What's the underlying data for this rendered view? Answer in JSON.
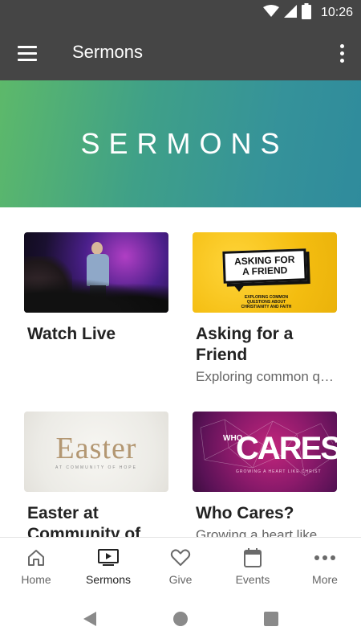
{
  "status_bar": {
    "time": "10:26"
  },
  "app_bar": {
    "title": "Sermons"
  },
  "hero": {
    "title": "SERMONS"
  },
  "cards": [
    {
      "title": "Watch Live",
      "subtitle": "",
      "thumb": "live-stage-photo"
    },
    {
      "title": "Asking for a Friend",
      "subtitle": "Exploring common q…",
      "thumb": "asking-for-a-friend-graphic",
      "thumb_text": {
        "headline_line1": "ASKING FOR",
        "headline_line2": "A FRIEND",
        "tagline": "EXPLORING COMMON QUESTIONS ABOUT CHRISTIANITY AND FAITH"
      }
    },
    {
      "title": "Easter at Community of",
      "subtitle": "",
      "thumb": "easter-graphic",
      "thumb_text": {
        "word": "Easter",
        "sub": "AT COMMUNITY OF HOPE"
      }
    },
    {
      "title": "Who Cares?",
      "subtitle": "Growing a heart like",
      "thumb": "who-cares-graphic",
      "thumb_text": {
        "who": "WHO",
        "cares": "CARES?",
        "sub": "GROWING A HEART LIKE CHRIST"
      }
    }
  ],
  "bottom_nav": [
    {
      "label": "Home",
      "icon": "home-icon",
      "active": false
    },
    {
      "label": "Sermons",
      "icon": "tv-icon",
      "active": true
    },
    {
      "label": "Give",
      "icon": "heart-icon",
      "active": false
    },
    {
      "label": "Events",
      "icon": "calendar-icon",
      "active": false
    },
    {
      "label": "More",
      "icon": "more-icon",
      "active": false
    }
  ],
  "colors": {
    "bar_bg": "#454545",
    "hero_gradient_start": "#5db96a",
    "hero_gradient_end": "#2f8b9c",
    "active_nav": "#222222",
    "inactive_nav": "#666666"
  }
}
